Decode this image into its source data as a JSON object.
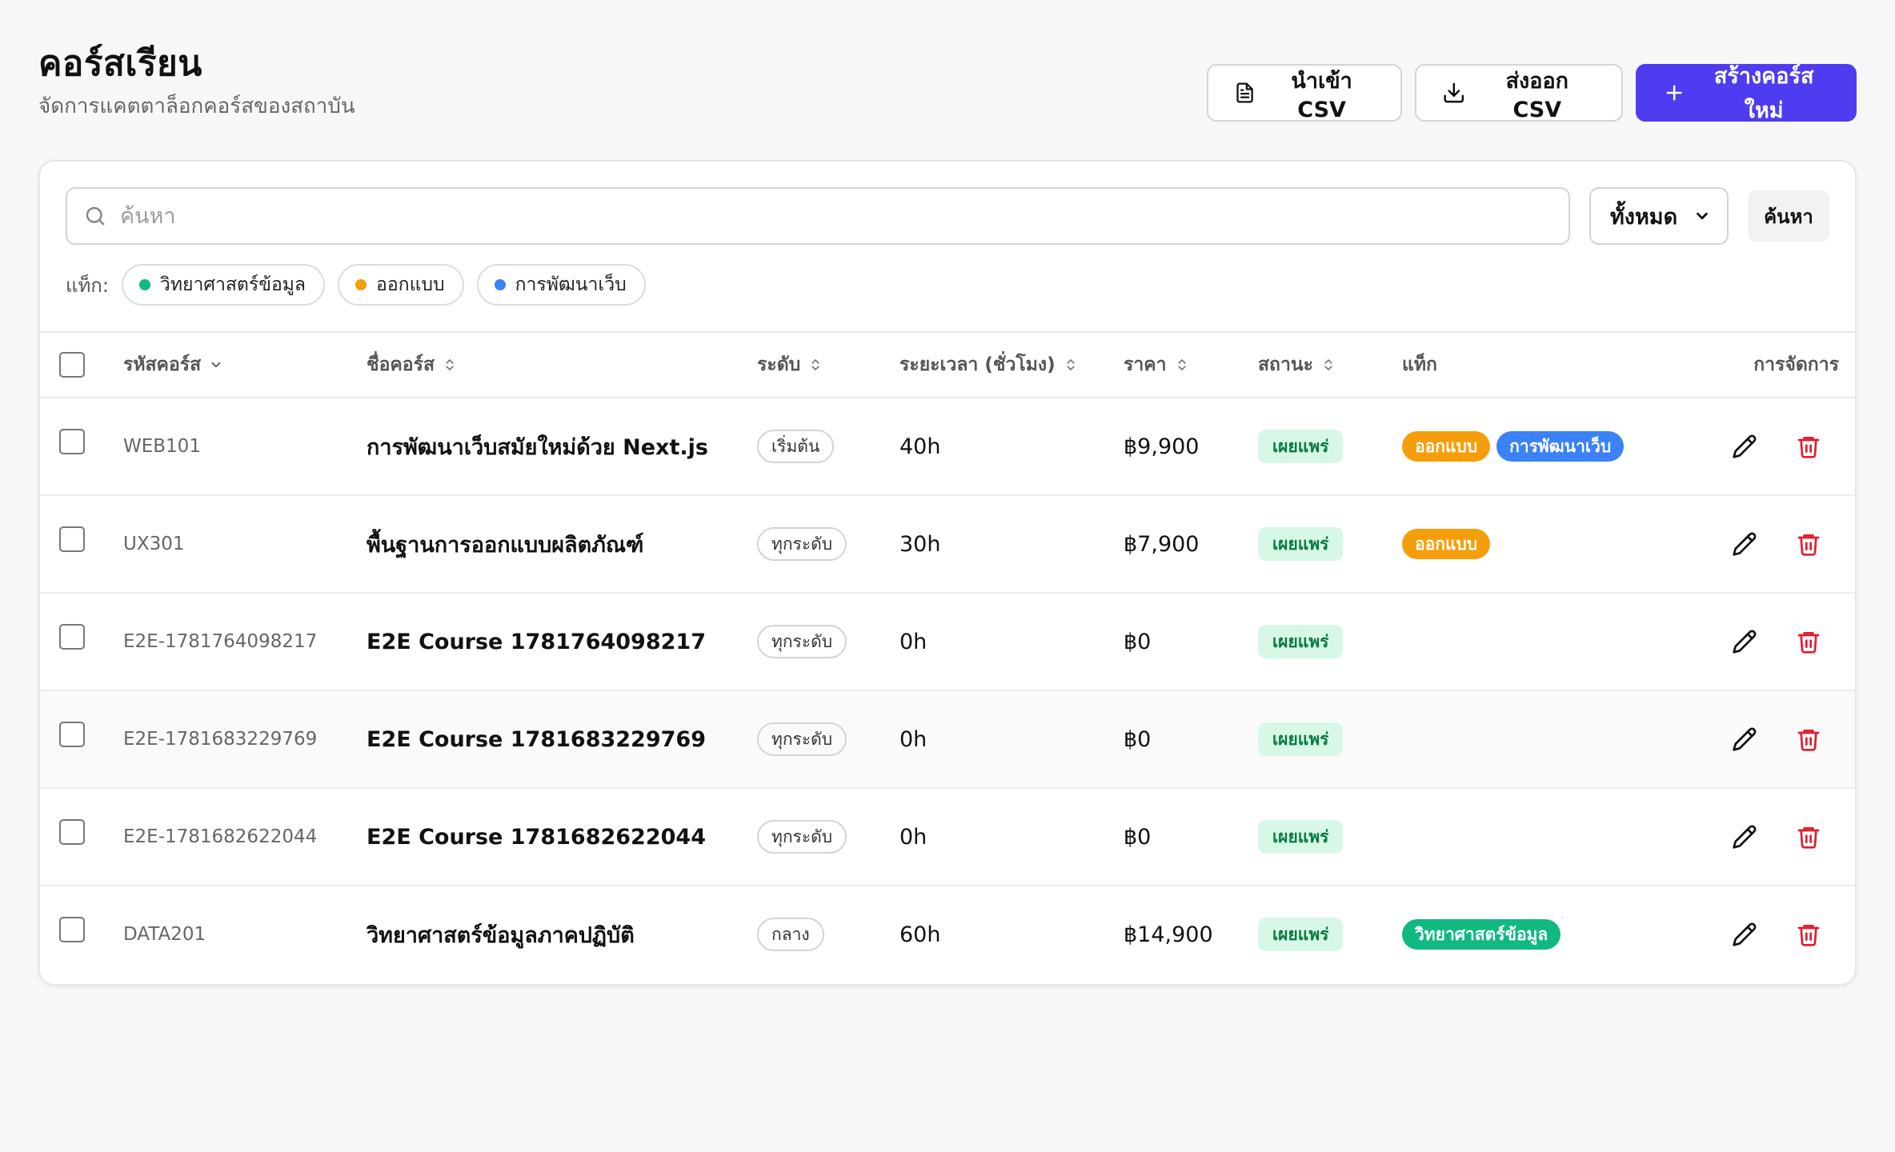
{
  "header": {
    "title": "คอร์สเรียน",
    "subtitle": "จัดการแคตตาล็อกคอร์สของสถาบัน"
  },
  "actions": {
    "import_label": "นำเข้า CSV",
    "export_label": "ส่งออก CSV",
    "create_label": "สร้างคอร์สใหม่"
  },
  "toolbar": {
    "search_placeholder": "ค้นหา",
    "search_value": "",
    "filter_selected": "ทั้งหมด",
    "search_button_label": "ค้นหา"
  },
  "tag_filter": {
    "label": "แท็ก:",
    "tags": [
      {
        "name": "วิทยาศาสตร์ข้อมูล",
        "color": "#10b981"
      },
      {
        "name": "ออกแบบ",
        "color": "#f59e0b"
      },
      {
        "name": "การพัฒนาเว็บ",
        "color": "#3b82f6"
      }
    ]
  },
  "table": {
    "columns": {
      "code": "รหัสคอร์ส",
      "name": "ชื่อคอร์ส",
      "level": "ระดับ",
      "duration": "ระยะเวลา (ชั่วโมง)",
      "price": "ราคา",
      "status": "สถานะ",
      "tags": "แท็ก",
      "actions": "การจัดการ"
    },
    "rows": [
      {
        "code": "WEB101",
        "name": "การพัฒนาเว็บสมัยใหม่ด้วย Next.js",
        "level": "เริ่มต้น",
        "duration": "40h",
        "price": "฿9,900",
        "status": "เผยแพร่",
        "tags": [
          {
            "name": "ออกแบบ",
            "color": "#f59e0b"
          },
          {
            "name": "การพัฒนาเว็บ",
            "color": "#3b82f6"
          }
        ]
      },
      {
        "code": "UX301",
        "name": "พื้นฐานการออกแบบผลิตภัณฑ์",
        "level": "ทุกระดับ",
        "duration": "30h",
        "price": "฿7,900",
        "status": "เผยแพร่",
        "tags": [
          {
            "name": "ออกแบบ",
            "color": "#f59e0b"
          }
        ]
      },
      {
        "code": "E2E-1781764098217",
        "name": "E2E Course 1781764098217",
        "level": "ทุกระดับ",
        "duration": "0h",
        "price": "฿0",
        "status": "เผยแพร่",
        "tags": []
      },
      {
        "code": "E2E-1781683229769",
        "name": "E2E Course 1781683229769",
        "level": "ทุกระดับ",
        "duration": "0h",
        "price": "฿0",
        "status": "เผยแพร่",
        "tags": []
      },
      {
        "code": "E2E-1781682622044",
        "name": "E2E Course 1781682622044",
        "level": "ทุกระดับ",
        "duration": "0h",
        "price": "฿0",
        "status": "เผยแพร่",
        "tags": []
      },
      {
        "code": "DATA201",
        "name": "วิทยาศาสตร์ข้อมูลภาคปฏิบัติ",
        "level": "กลาง",
        "duration": "60h",
        "price": "฿14,900",
        "status": "เผยแพร่",
        "tags": [
          {
            "name": "วิทยาศาสตร์ข้อมูล",
            "color": "#10b981"
          }
        ]
      }
    ]
  },
  "colors": {
    "primary": "#4f3cf0",
    "status_bg": "#d7f8e6",
    "status_text": "#087a44",
    "delete": "#e11d2e"
  }
}
